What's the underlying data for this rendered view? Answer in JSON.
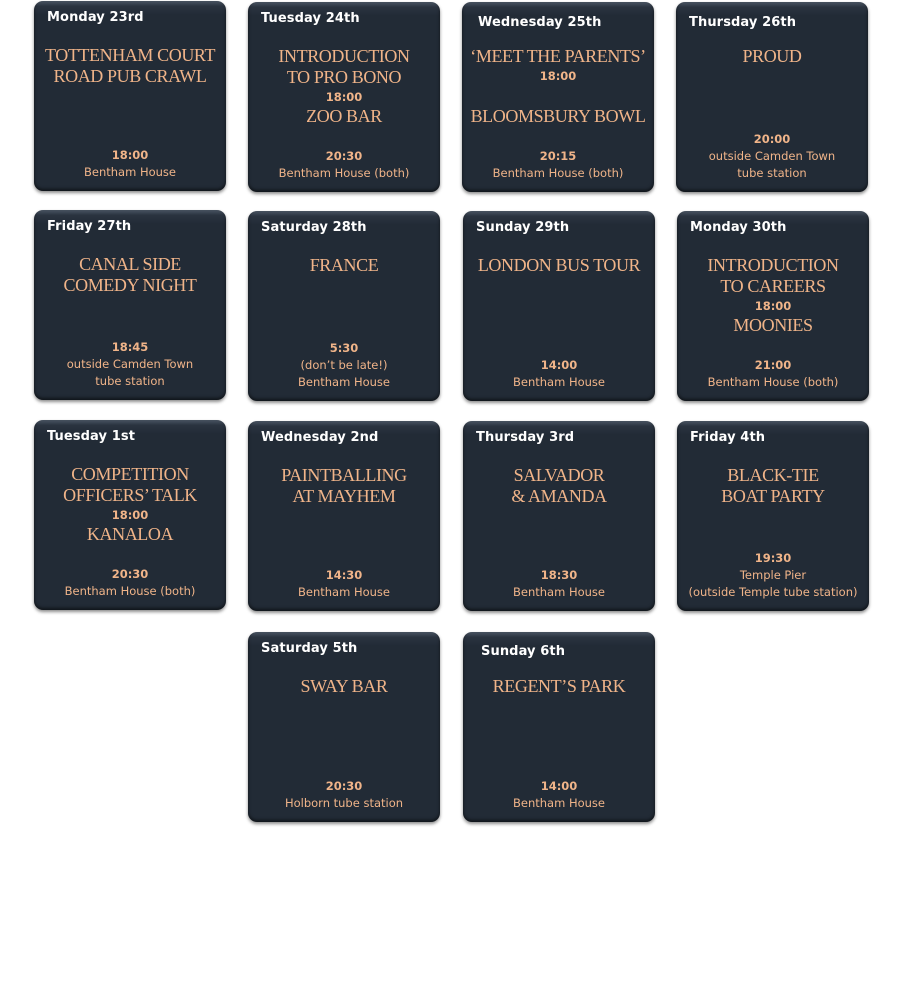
{
  "cards": [
    {
      "day": "Monday 23rd",
      "event1": "Tottenham Court\nRoad Pub Crawl",
      "time": "18:00",
      "location": "Bentham House"
    },
    {
      "day": "Tuesday 24th",
      "event1": "Introduction\nto Pro Bono",
      "time1": "18:00",
      "event2": "Zoo Bar",
      "time": "20:30",
      "location": "Bentham House (both)"
    },
    {
      "day": "Wednesday 25th",
      "event1": "‘Meet the Parents’",
      "time1": "18:00",
      "event2": "Bloomsbury Bowl",
      "time": "20:15",
      "location": "Bentham House (both)"
    },
    {
      "day": "Thursday 26th",
      "event1": "Proud",
      "time": "20:00",
      "location": "outside Camden Town\ntube station"
    },
    {
      "day": "Friday 27th",
      "event1": "Canal Side\nComedy Night",
      "time": "18:45",
      "location": "outside Camden Town\ntube station"
    },
    {
      "day": "Saturday 28th",
      "event1": "France",
      "time": "5:30",
      "location": "(don’t be late!)\nBentham House"
    },
    {
      "day": "Sunday 29th",
      "event1": "London Bus Tour",
      "time": "14:00",
      "location": "Bentham House"
    },
    {
      "day": "Monday 30th",
      "event1": "Introduction\nto Careers",
      "time1": "18:00",
      "event2": "Moonies",
      "time": "21:00",
      "location": "Bentham House (both)"
    },
    {
      "day": "Tuesday 1st",
      "event1": "Competition\nOfficers’ Talk",
      "time1": "18:00",
      "event2": "Kanaloa",
      "time": "20:30",
      "location": "Bentham House (both)"
    },
    {
      "day": "Wednesday 2nd",
      "event1": "Paintballing\nat Mayhem",
      "time": "14:30",
      "location": "Bentham House"
    },
    {
      "day": "Thursday 3rd",
      "event1": "Salvador\n& Amanda",
      "time": "18:30",
      "location": "Bentham House"
    },
    {
      "day": "Friday 4th",
      "event1": "Black-Tie\nBoat Party",
      "time": "19:30",
      "location": "Temple Pier\n(outside Temple tube station)"
    },
    {
      "day": "Saturday 5th",
      "event1": "Sway Bar",
      "time": "20:30",
      "location": "Holborn tube station"
    },
    {
      "day": "Sunday 6th",
      "event1": "Regent’s Park",
      "time": "14:00",
      "location": "Bentham House"
    }
  ],
  "colors": {
    "card_bg": "#222b36",
    "accent_text": "#f0b489",
    "day_text": "#ffffff"
  }
}
